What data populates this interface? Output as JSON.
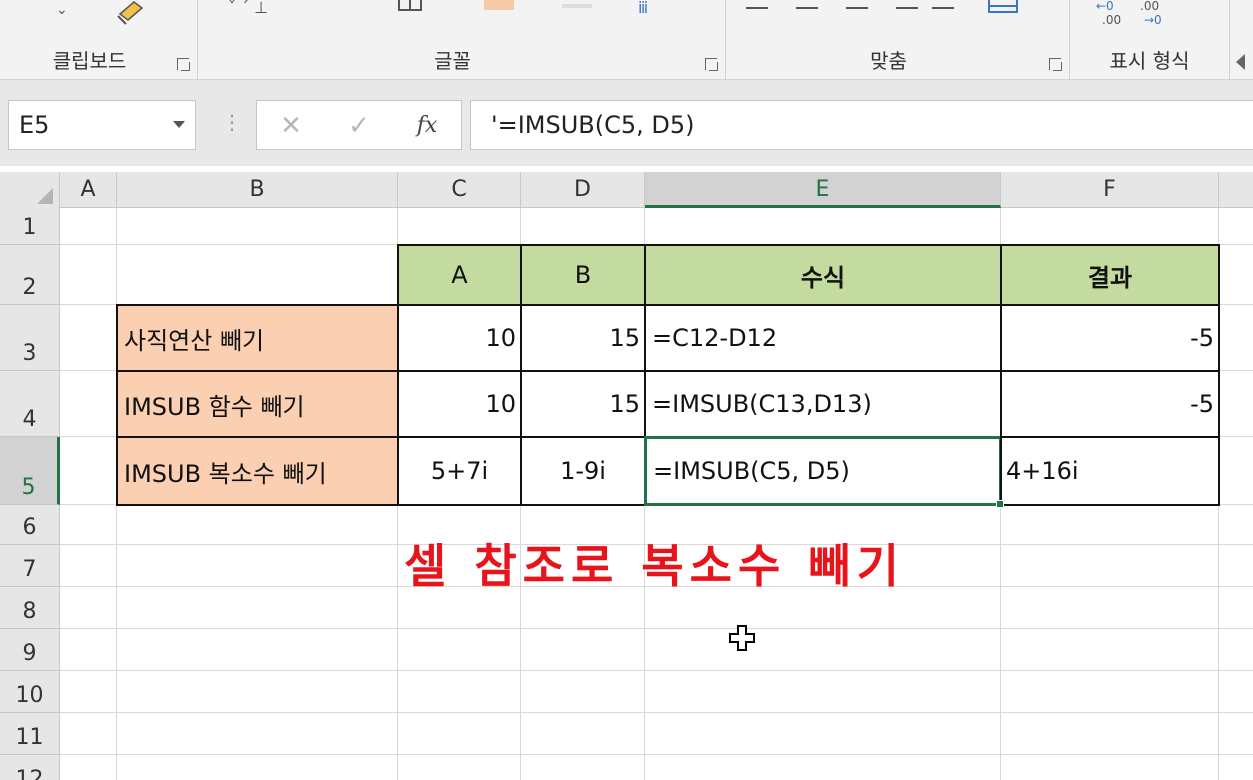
{
  "ribbon": {
    "groups": [
      {
        "label": "클립보드"
      },
      {
        "label": "글꼴"
      },
      {
        "label": "맞춤"
      },
      {
        "label": "표시 형식"
      }
    ]
  },
  "formula_bar": {
    "name_box": "E5",
    "cancel_icon": "✕",
    "enter_icon": "✓",
    "fx_label": "fx",
    "formula": "'=IMSUB(C5, D5)"
  },
  "columns": [
    "A",
    "B",
    "C",
    "D",
    "E",
    "F"
  ],
  "rows": [
    "1",
    "2",
    "3",
    "4",
    "5",
    "6",
    "7",
    "8",
    "9",
    "10",
    "11",
    "12"
  ],
  "active_cell": "E5",
  "table": {
    "headers": [
      "A",
      "B",
      "수식",
      "결과"
    ],
    "rows": [
      {
        "label": "사직연산 빼기",
        "a": "10",
        "b": "15",
        "formula": "=C12-D12",
        "result": "-5"
      },
      {
        "label": "IMSUB 함수 빼기",
        "a": "10",
        "b": "15",
        "formula": "=IMSUB(C13,D13)",
        "result": "-5"
      },
      {
        "label": "IMSUB 복소수 빼기",
        "a": "5+7i",
        "b": "1-9i",
        "formula": "=IMSUB(C5, D5)",
        "result": "4+16i"
      }
    ]
  },
  "annotation": "셀 참조로 복소수 빼기",
  "colors": {
    "header_fill": "#c4dba0",
    "label_fill": "#fbcfb2",
    "accent_green": "#217346",
    "annotation_red": "#e8141c"
  }
}
